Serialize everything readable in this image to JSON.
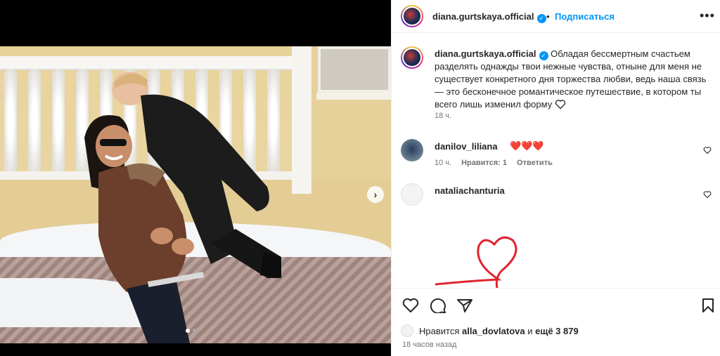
{
  "media": {
    "image_alt": "",
    "carousel": {
      "total": 2,
      "current": 1
    }
  },
  "header": {
    "username": "diana.gurtskaya.official",
    "separator": "•",
    "follow_label": "Подписаться",
    "more_label": "•••"
  },
  "caption": {
    "username": "diana.gurtskaya.official",
    "text": "Обладая бессмертным счастьем разделять однажды твои нежные чувства, отныне для меня не существует конкретного дня торжества любви, ведь наша связь — это бесконечное романтическое путешествие, в котором ты всего лишь изменил форму",
    "time": "18 ч."
  },
  "comments": [
    {
      "username": "danilov_liliana",
      "text": "❤️❤️❤️",
      "time": "10 ч.",
      "likes": "Нравится: 1",
      "reply_label": "Ответить"
    },
    {
      "username": "nataliachanturia",
      "text": ""
    }
  ],
  "likes": {
    "prefix": "Нравится",
    "user": "alla_dovlatova",
    "connector": "и",
    "others": "ещё 3 879"
  },
  "post_time": "18 часов назад",
  "colors": {
    "accent": "#0095f6",
    "heart": "#e0242f",
    "muted": "#737373"
  }
}
